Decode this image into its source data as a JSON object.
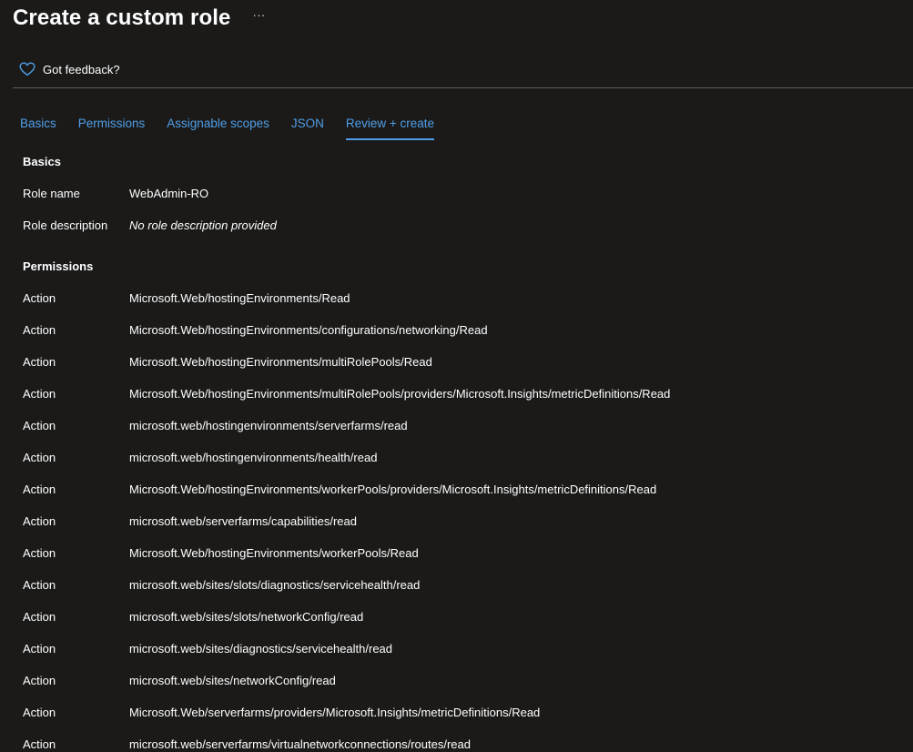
{
  "header": {
    "title": "Create a custom role",
    "more_label": "···"
  },
  "feedback": {
    "label": "Got feedback?",
    "icon": "heart-icon"
  },
  "tabs": [
    {
      "label": "Basics",
      "active": false
    },
    {
      "label": "Permissions",
      "active": false
    },
    {
      "label": "Assignable scopes",
      "active": false
    },
    {
      "label": "JSON",
      "active": false
    },
    {
      "label": "Review + create",
      "active": true
    }
  ],
  "basics": {
    "heading": "Basics",
    "role_name_label": "Role name",
    "role_name_value": "WebAdmin-RO",
    "role_description_label": "Role description",
    "role_description_value": "No role description provided"
  },
  "permissions": {
    "heading": "Permissions",
    "items": [
      {
        "type": "Action",
        "value": "Microsoft.Web/hostingEnvironments/Read"
      },
      {
        "type": "Action",
        "value": "Microsoft.Web/hostingEnvironments/configurations/networking/Read"
      },
      {
        "type": "Action",
        "value": "Microsoft.Web/hostingEnvironments/multiRolePools/Read"
      },
      {
        "type": "Action",
        "value": "Microsoft.Web/hostingEnvironments/multiRolePools/providers/Microsoft.Insights/metricDefinitions/Read"
      },
      {
        "type": "Action",
        "value": "microsoft.web/hostingenvironments/serverfarms/read"
      },
      {
        "type": "Action",
        "value": "microsoft.web/hostingenvironments/health/read"
      },
      {
        "type": "Action",
        "value": "Microsoft.Web/hostingEnvironments/workerPools/providers/Microsoft.Insights/metricDefinitions/Read"
      },
      {
        "type": "Action",
        "value": "microsoft.web/serverfarms/capabilities/read"
      },
      {
        "type": "Action",
        "value": "Microsoft.Web/hostingEnvironments/workerPools/Read"
      },
      {
        "type": "Action",
        "value": "microsoft.web/sites/slots/diagnostics/servicehealth/read"
      },
      {
        "type": "Action",
        "value": "microsoft.web/sites/slots/networkConfig/read"
      },
      {
        "type": "Action",
        "value": "microsoft.web/sites/diagnostics/servicehealth/read"
      },
      {
        "type": "Action",
        "value": "microsoft.web/sites/networkConfig/read"
      },
      {
        "type": "Action",
        "value": "Microsoft.Web/serverfarms/providers/Microsoft.Insights/metricDefinitions/Read"
      },
      {
        "type": "Action",
        "value": "microsoft.web/serverfarms/virtualnetworkconnections/routes/read"
      }
    ]
  },
  "colors": {
    "background": "#1b1a19",
    "accent": "#4f9fe8",
    "divider": "#605e5c"
  }
}
